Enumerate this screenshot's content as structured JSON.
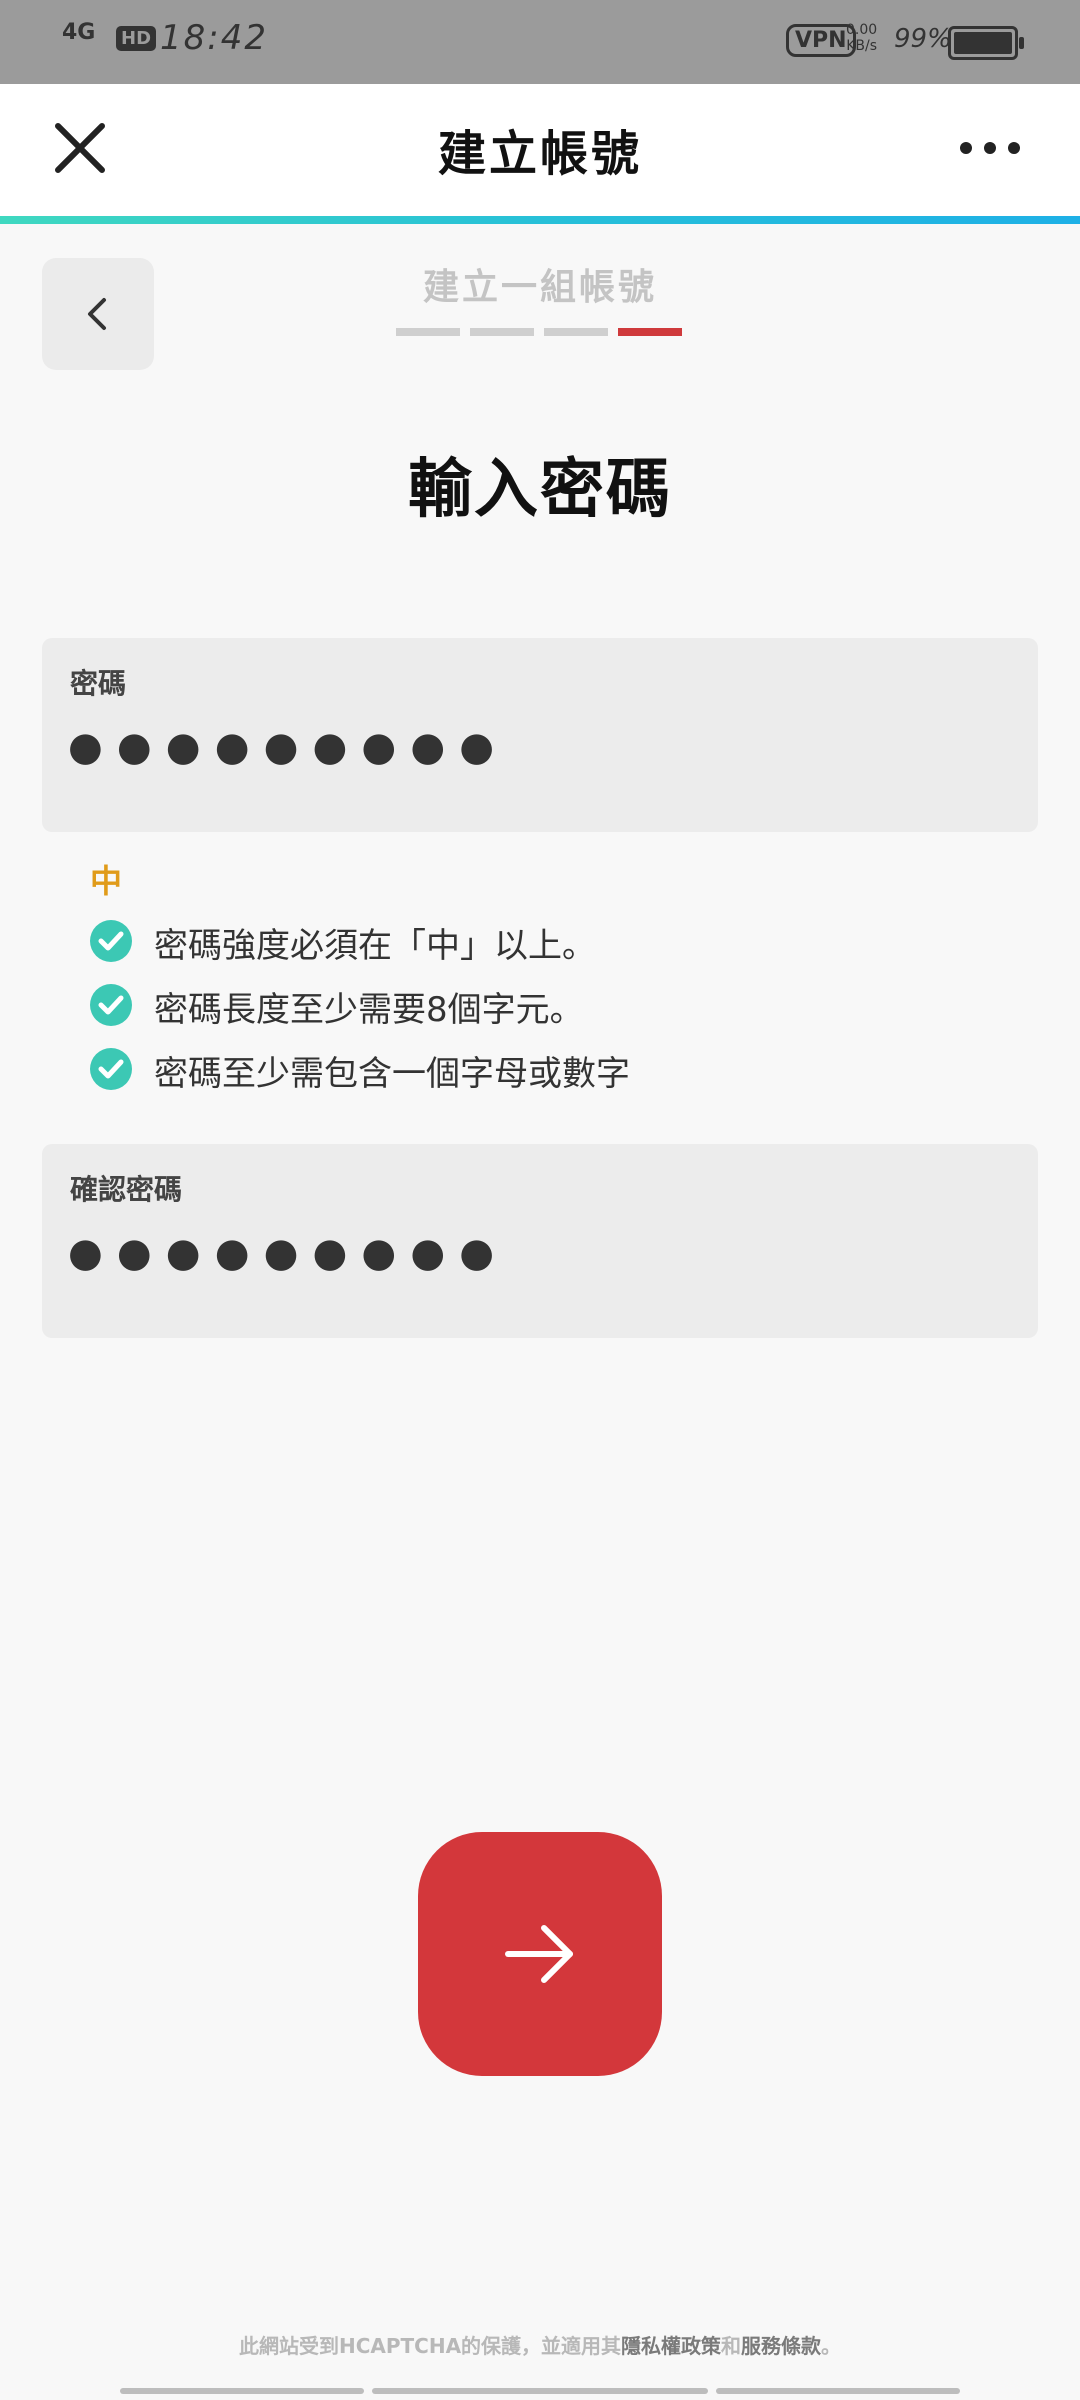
{
  "status_bar": {
    "network": "4G",
    "hd": "HD",
    "time": "18:42",
    "vpn": "VPN",
    "rate_value": "0.00",
    "rate_unit": "KB/s",
    "battery": "99%"
  },
  "app_bar": {
    "title": "建立帳號",
    "close_icon": "close-icon",
    "more_icon": "more-icon"
  },
  "progress": {
    "step_title": "建立一組帳號",
    "total_steps": 4,
    "current_step": 4
  },
  "page": {
    "heading": "輸入密碼"
  },
  "password_field": {
    "label": "密碼",
    "value": "●●●●●●●●●"
  },
  "strength": {
    "level": "中",
    "color": "#e09b1a"
  },
  "rules": [
    {
      "text": "密碼強度必須在「中」以上。",
      "met": true
    },
    {
      "text": "密碼長度至少需要8個字元。",
      "met": true
    },
    {
      "text": "密碼至少需包含一個字母或數字",
      "met": true
    }
  ],
  "confirm_field": {
    "label": "確認密碼",
    "value": "●●●●●●●●●"
  },
  "next_button": {
    "icon": "arrow-right-icon",
    "color": "#d3373b"
  },
  "footer": {
    "prefix": "此網站受到HCAPTCHA的保護，並適用其",
    "privacy_link": "隱私權政策",
    "and": "和",
    "terms_link": "服務條款",
    "suffix": "。"
  },
  "colors": {
    "accent_red": "#cf3a3c",
    "check_teal": "#3cc8b4"
  }
}
